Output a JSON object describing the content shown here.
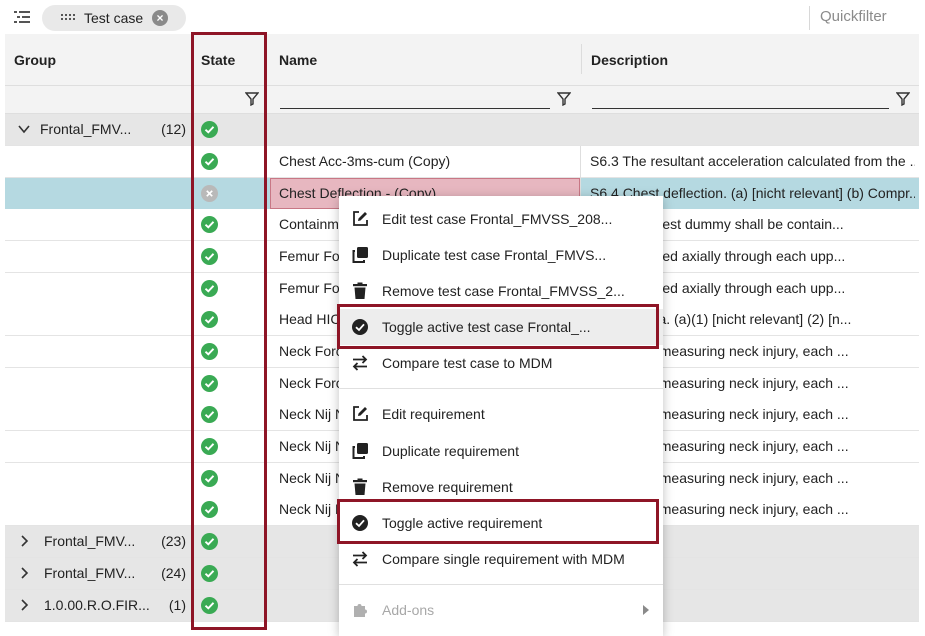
{
  "toolbar": {
    "chip_label": "Test case",
    "quickfilter_placeholder": "Quickfilter"
  },
  "columns": {
    "group": "Group",
    "state": "State",
    "name": "Name",
    "description": "Description"
  },
  "group_rows": [
    {
      "name": "Frontal_FMV...",
      "count": "(12)",
      "expanded": true
    },
    {
      "name": "Frontal_FMV...",
      "count": "(23)",
      "expanded": false
    },
    {
      "name": "Frontal_FMV...",
      "count": "(24)",
      "expanded": false
    },
    {
      "name": "1.0.00.R.O.FIR...",
      "count": "(1)",
      "expanded": false
    }
  ],
  "rows": [
    {
      "state": "active",
      "name": "Chest Acc-3ms-cum (Copy)",
      "description": "S6.3 The resultant acceleration calculated from the ..."
    },
    {
      "state": "inactive",
      "name": "Chest Deflection - (Copy)",
      "description": "S6.4 Chest deflection. (a) [nicht relevant] (b) Compr..."
    },
    {
      "state": "active",
      "name": "Containm",
      "description": "ions of the test dummy shall be contain..."
    },
    {
      "state": "active",
      "name": "Femur Fo",
      "description": "ce transmitted axially through each upp..."
    },
    {
      "state": "active",
      "name": "Femur Fo",
      "description": "ce transmitted axially through each upp..."
    },
    {
      "state": "active",
      "name": "Head HIC",
      "description": "njury criteria. (a)(1) [nicht relevant] (2) [n..."
    },
    {
      "state": "active",
      "name": "Neck Forc",
      "description": "jury. When measuring neck injury, each ..."
    },
    {
      "state": "active",
      "name": "Neck Forc",
      "description": "jury. When measuring neck injury, each ..."
    },
    {
      "state": "active",
      "name": "Neck Nij N",
      "description": "jury. When measuring neck injury, each ..."
    },
    {
      "state": "active",
      "name": "Neck Nij N",
      "description": "jury. When measuring neck injury, each ..."
    },
    {
      "state": "active",
      "name": "Neck Nij N",
      "description": "jury. When measuring neck injury, each ..."
    },
    {
      "state": "active",
      "name": "Neck Nij N",
      "description": "jury. When measuring neck injury, each ..."
    }
  ],
  "context_menu": {
    "items": [
      {
        "label": "Edit test case Frontal_FMVSS_208...",
        "icon": "edit-icon"
      },
      {
        "label": "Duplicate test case Frontal_FMVS...",
        "icon": "duplicate-icon"
      },
      {
        "label": "Remove test case Frontal_FMVSS_2...",
        "icon": "trash-icon"
      },
      {
        "label": "Toggle active test case Frontal_...",
        "icon": "check-circle-icon"
      },
      {
        "label": "Compare test case to MDM",
        "icon": "compare-icon"
      },
      {
        "label": "Edit requirement",
        "icon": "edit-icon"
      },
      {
        "label": "Duplicate requirement",
        "icon": "duplicate-icon"
      },
      {
        "label": "Remove requirement",
        "icon": "trash-icon"
      },
      {
        "label": "Toggle active requirement",
        "icon": "check-circle-icon"
      },
      {
        "label": "Compare single requirement with MDM",
        "icon": "compare-icon"
      },
      {
        "label": "Add-ons",
        "icon": "puzzle-icon",
        "disabled": true
      }
    ]
  },
  "colors": {
    "accent_highlight": "#8e1526",
    "state_ok": "#3aaa54",
    "selected_row": "#b5d9e1"
  }
}
